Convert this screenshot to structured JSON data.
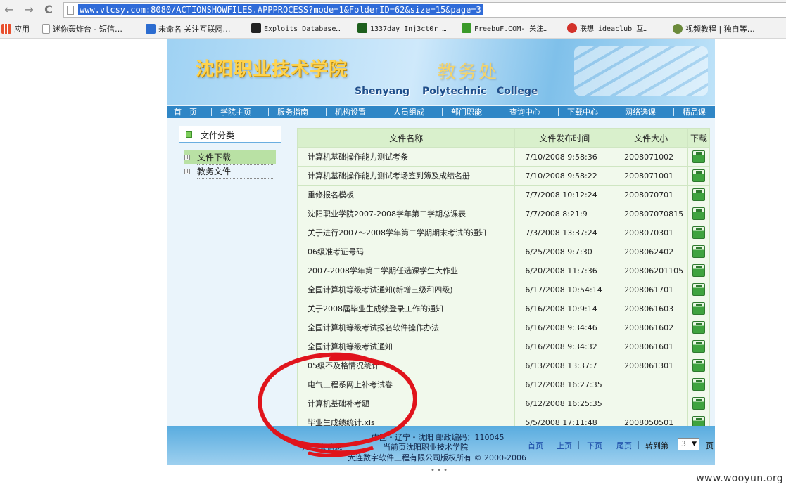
{
  "browser": {
    "url": "www.vtcsy.com:8080/ACTIONSHOWFILES.APPPROCESS?mode=1&FolderID=62&size=15&page=3",
    "back_glyph": "←",
    "forward_glyph": "→",
    "reload_glyph": "C",
    "bookmarks": [
      {
        "label": "应用",
        "icon": "apps-grid-icon",
        "color": "#e8502f"
      },
      {
        "label": "迷你轰炸台 - 短信…",
        "icon": "page-icon",
        "color": "#ffffff"
      },
      {
        "label": "未命名 关注互联网…",
        "icon": "mb-icon",
        "color": "#2c6cd0"
      },
      {
        "label": "Exploits Database…",
        "icon": "exploits-icon",
        "color": "#222222"
      },
      {
        "label": "1337day Inj3ct0r …",
        "icon": "1337day-icon",
        "color": "#1d5f1d"
      },
      {
        "label": "FreebuF.COM- 关注…",
        "icon": "freebuf-icon",
        "color": "#3a9a2a"
      },
      {
        "label": "联想 ideaclub 互…",
        "icon": "lenovo-icon",
        "color": "#d3322b"
      },
      {
        "label": "视频教程 | 独自等…",
        "icon": "avatar-icon",
        "color": "#6b8a3b"
      }
    ]
  },
  "site": {
    "title_cn": "沈阳职业技术学院",
    "dept": "教务处",
    "title_en": [
      "Shenyang",
      "Polytechnic",
      "College"
    ],
    "nav": [
      "首　页",
      "学院主页",
      "服务指南",
      "机构设置",
      "人员组成",
      "部门职能",
      "查询中心",
      "下载中心",
      "网络选课",
      "精品课"
    ]
  },
  "sidebar": {
    "heading": "文件分类",
    "items": [
      {
        "label": "文件下载",
        "active": true
      },
      {
        "label": "教务文件",
        "active": false
      }
    ]
  },
  "table": {
    "headers": [
      "文件名称",
      "文件发布时间",
      "文件大小",
      "下载"
    ],
    "rows": [
      {
        "name": "计算机基础操作能力测试考条",
        "time": "7/10/2008 9:58:36",
        "size": "2008071002"
      },
      {
        "name": "计算机基础操作能力测试考场签到簿及成绩名册",
        "time": "7/10/2008 9:58:22",
        "size": "2008071001"
      },
      {
        "name": "重修报名模板",
        "time": "7/7/2008 10:12:24",
        "size": "2008070701"
      },
      {
        "name": "沈阳职业学院2007-2008学年第二学期总课表",
        "time": "7/7/2008 8:21:9",
        "size": "200807070815"
      },
      {
        "name": "关于进行2007～2008学年第二学期期末考试的通知",
        "time": "7/3/2008 13:37:24",
        "size": "2008070301"
      },
      {
        "name": "06级准考证号码",
        "time": "6/25/2008 9:7:30",
        "size": "2008062402"
      },
      {
        "name": "2007-2008学年第二学期任选课学生大作业",
        "time": "6/20/2008 11:7:36",
        "size": "200806201105"
      },
      {
        "name": "全国计算机等级考试通知(新增三级和四级)",
        "time": "6/17/2008 10:54:14",
        "size": "2008061701"
      },
      {
        "name": "关于2008届毕业生成绩登录工作的通知",
        "time": "6/16/2008 10:9:14",
        "size": "2008061603"
      },
      {
        "name": "全国计算机等级考试报名软件操作办法",
        "time": "6/16/2008 9:34:46",
        "size": "2008061602"
      },
      {
        "name": "全国计算机等级考试通知",
        "time": "6/16/2008 9:34:32",
        "size": "2008061601"
      },
      {
        "name": "05级不及格情况统计",
        "time": "6/13/2008 13:37:7",
        "size": "2008061301"
      },
      {
        "name": "电气工程系网上补考试卷",
        "time": "6/12/2008 16:27:35",
        "size": ""
      },
      {
        "name": "计算机基础补考题",
        "time": "6/12/2008 16:25:35",
        "size": ""
      },
      {
        "name": "毕业生成绩统计.xls",
        "time": "5/5/2008 17:11:48",
        "size": "2008050501"
      }
    ]
  },
  "footer": {
    "line1": "中国・辽宁・沈阳 邮政编码：110045",
    "line2_left": "共…  条信息",
    "line2_mid": "当前页沈阳职业技术学院",
    "line3": "大连数字软件工程有限公司版权所有 © 2000-2006",
    "pager": {
      "first": "首页",
      "prev": "上页",
      "next": "下页",
      "last": "尾页",
      "goto": "转到第",
      "page_value": "3",
      "page_suffix": "页"
    }
  },
  "watermark": "www.wooyun.org",
  "colors": {
    "nav_bar": "#2f86c6",
    "row_bg": "#f1f9ec",
    "header_bg": "#d9f0cc",
    "scribble": "#e0141c",
    "banner_title": "#ffd34d"
  }
}
